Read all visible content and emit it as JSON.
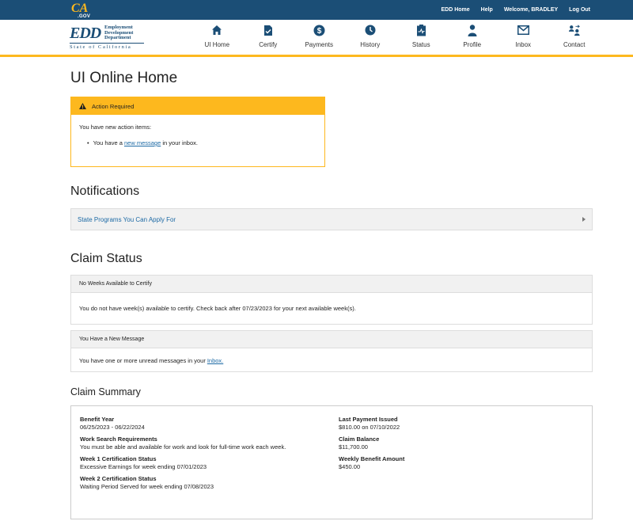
{
  "top_bar": {
    "ca_logo": "CA",
    "ca_logo_sub": ".GOV",
    "links": [
      "EDD Home",
      "Help",
      "Welcome, BRADLEY",
      "Log Out"
    ]
  },
  "logo": {
    "edd": "EDD",
    "line1": "Employment",
    "line2": "Development",
    "line3": "Department",
    "state": "State of California"
  },
  "nav": [
    {
      "label": "UI Home",
      "icon": "home-icon"
    },
    {
      "label": "Certify",
      "icon": "certify-icon"
    },
    {
      "label": "Payments",
      "icon": "dollar-icon"
    },
    {
      "label": "History",
      "icon": "clock-icon"
    },
    {
      "label": "Status",
      "icon": "status-icon"
    },
    {
      "label": "Profile",
      "icon": "user-icon"
    },
    {
      "label": "Inbox",
      "icon": "envelope-icon"
    },
    {
      "label": "Contact",
      "icon": "contact-icon"
    }
  ],
  "page_title": "UI Online Home",
  "action": {
    "header": "Action Required",
    "intro": "You have new action items:",
    "item_prefix": "You have a ",
    "item_link": "new message",
    "item_suffix": " in your inbox."
  },
  "notifications": {
    "title": "Notifications",
    "bar_label": "State Programs You Can Apply For"
  },
  "claim_status": {
    "title": "Claim Status",
    "card1_header": "No Weeks Available to Certify",
    "card1_body": "You do not have week(s) available to certify. Check back after 07/23/2023 for your next available week(s).",
    "card2_header": "You Have a New Message",
    "card2_body_prefix": "You have one or more unread messages in your ",
    "card2_link": "Inbox."
  },
  "summary": {
    "title": "Claim Summary",
    "left": [
      {
        "label": "Benefit Year",
        "value": "06/25/2023 - 06/22/2024"
      },
      {
        "label": "Work Search Requirements",
        "value": "You must be able and available for work and look for full-time work each week."
      },
      {
        "label": "Week 1 Certification Status",
        "value": "Excessive Earnings for week ending 07/01/2023"
      },
      {
        "label": "Week 2 Certification Status",
        "value": "Waiting Period Served for week ending 07/08/2023"
      }
    ],
    "right": [
      {
        "label": "Last Payment Issued",
        "value": "$810.00 on 07/10/2022"
      },
      {
        "label": "Claim Balance",
        "value": "$11,700.00"
      },
      {
        "label": "Weekly Benefit Amount",
        "value": "$450.00"
      }
    ]
  },
  "colors": {
    "top_bar": "#1b4e76",
    "accent": "#fdb81e",
    "link": "#1d6aa5"
  }
}
